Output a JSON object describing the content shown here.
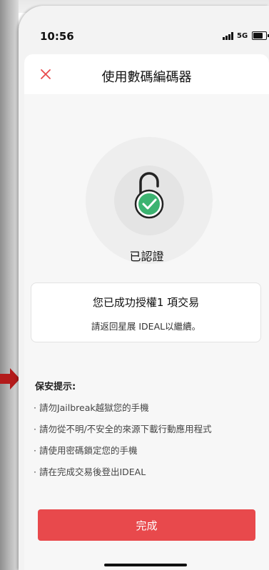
{
  "status_bar": {
    "time": "10:56",
    "network": "5G"
  },
  "header": {
    "title": "使用數碼編碼器",
    "close_icon": "close-icon"
  },
  "main": {
    "lock_icon": "padlock-check-icon",
    "status_label": "已認證",
    "card": {
      "title": "您已成功授權1 項交易",
      "subtitle": "請返回星展 IDEAL以繼續。"
    },
    "tips": {
      "title": "保安提示:",
      "items": [
        "· 請勿Jailbreak越獄您的手機",
        "· 請勿從不明/不安全的來源下載行動應用程式",
        "· 請使用密碼鎖定您的手機",
        "· 請在完成交易後登出IDEAL"
      ]
    }
  },
  "footer": {
    "done_label": "完成"
  },
  "colors": {
    "accent_red": "#e8494c",
    "check_green": "#3cb371",
    "arrow_red": "#b31b1b"
  }
}
